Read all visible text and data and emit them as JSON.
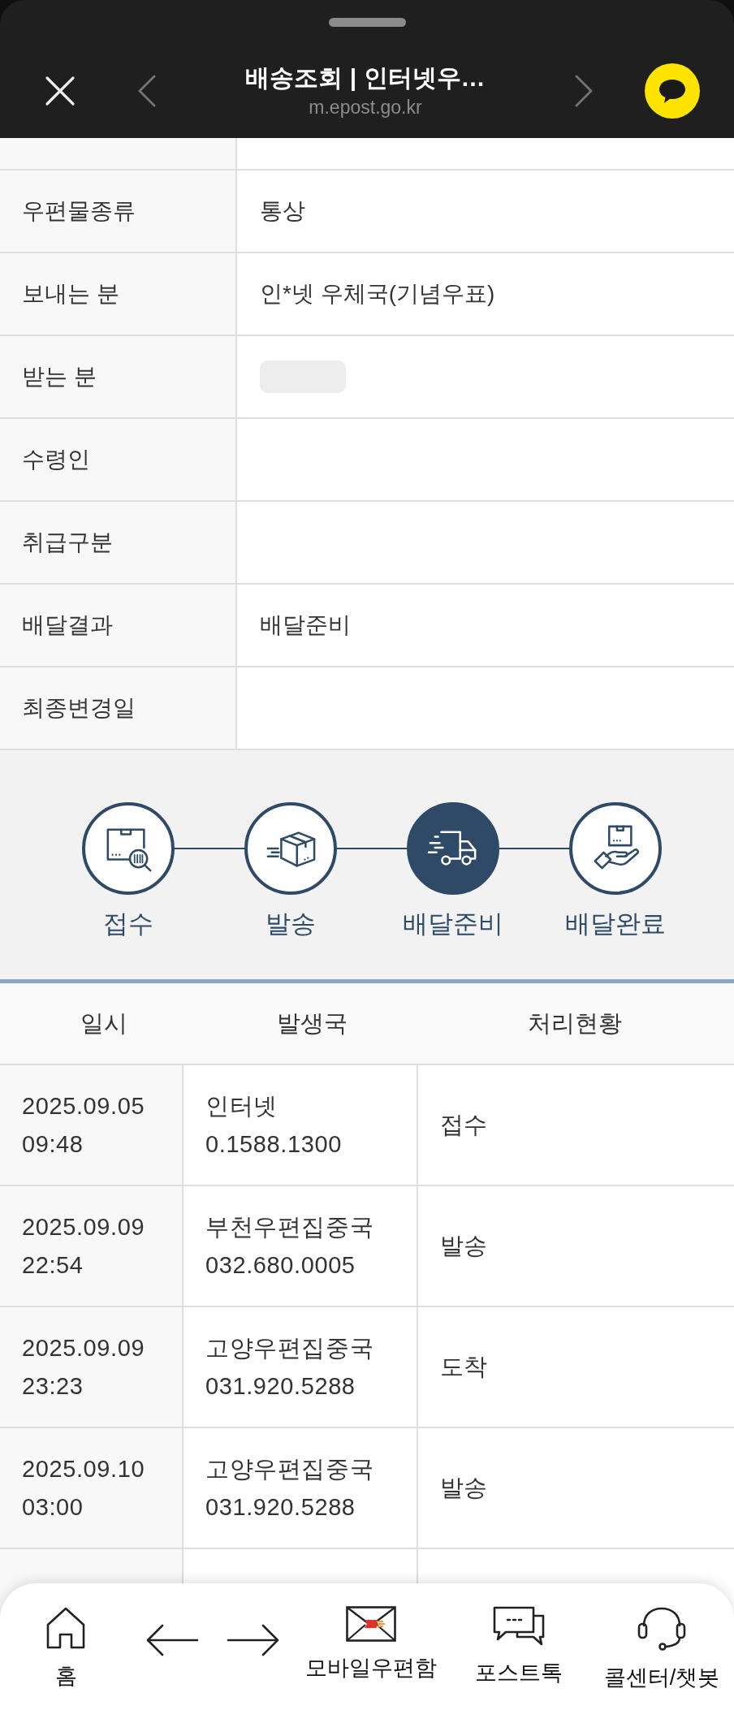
{
  "header": {
    "title": "배송조회 | 인터넷우…",
    "url": "m.epost.go.kr"
  },
  "details": [
    {
      "label": "우편물종류",
      "value": "통상"
    },
    {
      "label": "보내는 분",
      "value": "인*넷 우체국(기념우표)"
    },
    {
      "label": "받는 분",
      "redacted": true
    },
    {
      "label": "수령인"
    },
    {
      "label": "취급구분"
    },
    {
      "label": "배달결과",
      "value": "배달준비"
    },
    {
      "label": "최종변경일"
    }
  ],
  "progress": [
    {
      "kind": "received",
      "label": "접수",
      "active": false
    },
    {
      "kind": "dispatched",
      "label": "발송",
      "active": false
    },
    {
      "kind": "preparing",
      "label": "배달준비",
      "active": true
    },
    {
      "kind": "delivered",
      "label": "배달완료",
      "active": false
    }
  ],
  "history": {
    "columns": [
      "일시",
      "발생국",
      "처리현황"
    ],
    "rows": [
      {
        "date": "2025.09.05",
        "time": "09:48",
        "office": "인터넷",
        "phone": "0.1588.1300",
        "status": "접수"
      },
      {
        "date": "2025.09.09",
        "time": "22:54",
        "office": "부천우편집중국",
        "phone": "032.680.0005",
        "status": "발송"
      },
      {
        "date": "2025.09.09",
        "time": "23:23",
        "office": "고양우편집중국",
        "phone": "031.920.5288",
        "status": "도착"
      },
      {
        "date": "2025.09.10",
        "time": "03:00",
        "office": "고양우편집중국",
        "phone": "031.920.5288",
        "status": "발송"
      }
    ]
  },
  "bottom_nav": [
    {
      "kind": "home",
      "label": "홈"
    },
    {
      "kind": "back"
    },
    {
      "kind": "forward"
    },
    {
      "kind": "mailbox",
      "label": "모바일우편함"
    },
    {
      "kind": "talk",
      "label": "포스트톡"
    },
    {
      "kind": "support",
      "label": "콜센터/챗봇"
    }
  ]
}
